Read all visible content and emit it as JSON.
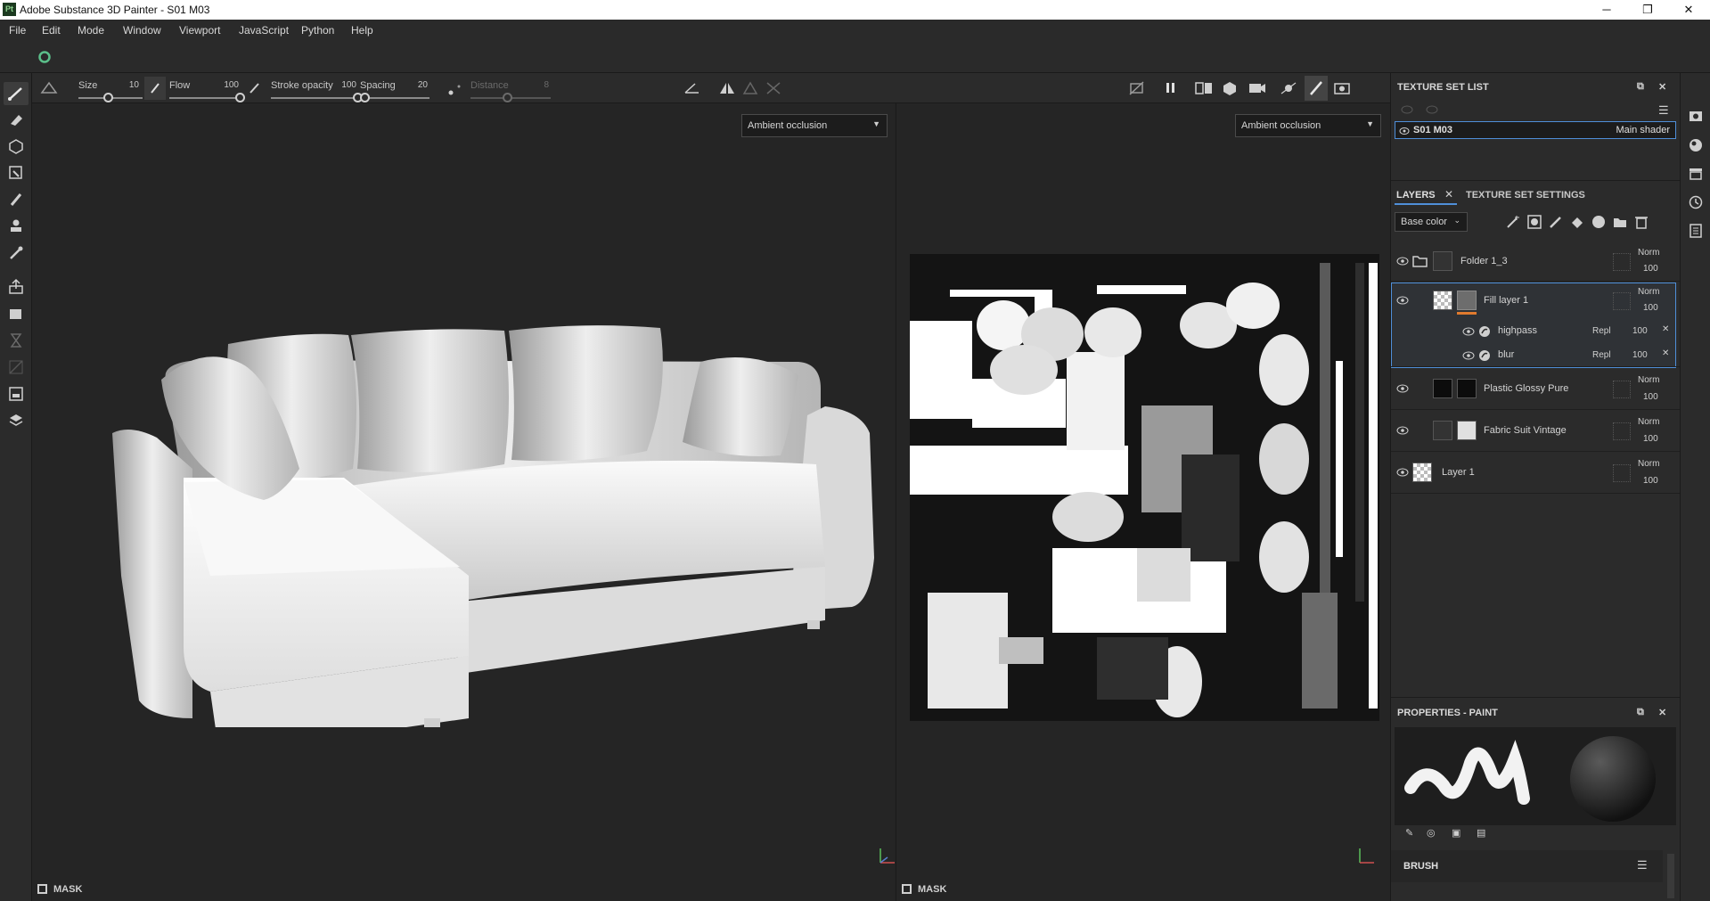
{
  "app": {
    "title": "Adobe Substance 3D Painter - S01 M03",
    "logo": "Pt",
    "window_controls": [
      "─",
      "❐",
      "✕"
    ]
  },
  "menu": [
    "File",
    "Edit",
    "Mode",
    "Window",
    "Viewport",
    "JavaScript",
    "Python",
    "Help"
  ],
  "tool_options": {
    "size_label": "Size",
    "size_value": "10",
    "flow_label": "Flow",
    "flow_value": "100",
    "stroke_opacity_label": "Stroke opacity",
    "stroke_opacity_value": "100",
    "spacing_label": "Spacing",
    "spacing_value": "20",
    "distance_label": "Distance",
    "distance_value": "8"
  },
  "viewports": {
    "left_channel": "Ambient occlusion",
    "right_channel": "Ambient occlusion",
    "mask_label": "MASK",
    "mask_label_2": "MASK"
  },
  "texture_set_list": {
    "title": "TEXTURE SET LIST",
    "set_name": "S01 M03",
    "shader": "Main shader"
  },
  "layers_panel": {
    "tab_layers": "LAYERS",
    "tab_texture_settings": "TEXTURE SET SETTINGS",
    "channel": "Base color",
    "layers": [
      {
        "name": "Folder 1_3",
        "blend": "Norm",
        "opacity": "100"
      },
      {
        "name": "Fill layer 1",
        "blend": "Norm",
        "opacity": "100"
      },
      {
        "name": "highpass",
        "blend": "Repl",
        "opacity": "100"
      },
      {
        "name": "blur",
        "blend": "Repl",
        "opacity": "100"
      },
      {
        "name": "Plastic Glossy Pure",
        "blend": "Norm",
        "opacity": "100"
      },
      {
        "name": "Fabric Suit Vintage",
        "blend": "Norm",
        "opacity": "100"
      },
      {
        "name": "Layer 1",
        "blend": "Norm",
        "opacity": "100"
      }
    ]
  },
  "properties": {
    "title": "PROPERTIES - PAINT",
    "brush_label": "BRUSH"
  },
  "colors": {
    "accent": "#4f8fd9",
    "fill_bar": "#e07a2e",
    "panel_bg": "#2b2b2b",
    "viewport_bg": "#252525"
  },
  "icons": {
    "left_tools": [
      "paint-brush-icon",
      "eraser-icon",
      "projection-icon",
      "polygon-fill-icon",
      "smudge-icon",
      "clone-icon",
      "color-picker-icon",
      "bake-icon",
      "material-picker-icon",
      "hourglass-icon",
      "geometry-mask-icon",
      "export-icon",
      "display-settings-icon"
    ],
    "right_strip": [
      "viewer-settings-icon",
      "environment-icon",
      "shelf-icon",
      "history-icon",
      "log-icon"
    ]
  }
}
